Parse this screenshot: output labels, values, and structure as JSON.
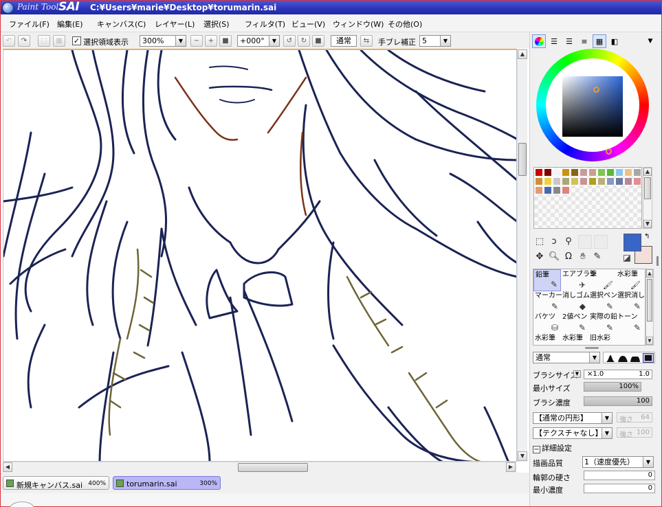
{
  "titlebar": {
    "logo_text": "Paint Tool",
    "logo_brand": "SAI",
    "path": "C:¥Users¥marie¥Desktop¥torumarin.sai"
  },
  "menu": [
    {
      "label": "ファイル(F)"
    },
    {
      "label": "編集(E)"
    },
    {
      "label": "キャンバス(C)"
    },
    {
      "label": "レイヤー(L)"
    },
    {
      "label": "選択(S)"
    },
    {
      "label": "フィルタ(T)"
    },
    {
      "label": "ビュー(V)"
    },
    {
      "label": "ウィンドウ(W)"
    },
    {
      "label": "その他(O)"
    }
  ],
  "toolbar": {
    "selection_display_label": "選択領域表示",
    "selection_display_checked": true,
    "zoom": "300%",
    "rotation": "+000°",
    "blend_mode": "通常",
    "stabilizer_label": "手ブレ補正",
    "stabilizer_value": "5"
  },
  "file_tabs": [
    {
      "name": "新規キャンバス.sai",
      "zoom": "400%",
      "active": false
    },
    {
      "name": "torumarin.sai",
      "zoom": "300%",
      "active": true
    }
  ],
  "colors": {
    "main": "#3866c8",
    "sub": "#f2dfd9",
    "line_art": "#1b2354",
    "skin_line": "#7a3318",
    "collar_line": "#6d6536"
  },
  "swatches": [
    "#c80000",
    "#800000",
    "#f4f4f4",
    "#c89214",
    "#8a6418",
    "#c89c9c",
    "#c8a090",
    "#7ac850",
    "#58b838",
    "#8ac8e8",
    "#f0c080",
    "#a8a8a8",
    "#d09030",
    "#f0d040",
    "#c8c8c8",
    "#a8a870",
    "#d0c060",
    "#c89498",
    "#b0a020",
    "#b8b078",
    "#8898c0",
    "#6878a0",
    "#b88898",
    "#e09090",
    "#e89870",
    "#4868b0",
    "#888888",
    "#e08080"
  ],
  "brushes": [
    {
      "label": "鉛筆",
      "icon": "pencil-icon",
      "active": true
    },
    {
      "label": "エアブラシ",
      "icon": "airbrush-icon",
      "active": false
    },
    {
      "label": "筆",
      "icon": "brush-icon",
      "active": false
    },
    {
      "label": "水彩筆",
      "icon": "watercolor-icon",
      "active": false
    },
    {
      "label": "マーカー",
      "icon": "marker-icon",
      "active": false
    },
    {
      "label": "消しゴム",
      "icon": "eraser-icon",
      "active": false
    },
    {
      "label": "選択ペン",
      "icon": "select-pen-icon",
      "active": false
    },
    {
      "label": "選択消し",
      "icon": "select-erase-icon",
      "active": false
    },
    {
      "label": "バケツ",
      "icon": "bucket-icon",
      "active": false
    },
    {
      "label": "2値ペン",
      "icon": "binary-pen-icon",
      "active": false
    },
    {
      "label": "実際の鉛",
      "icon": "real-pencil-icon",
      "active": false
    },
    {
      "label": "トーン",
      "icon": "tone-icon",
      "active": false
    },
    {
      "label": "水彩筆",
      "icon": "watercolor-icon",
      "active": false
    },
    {
      "label": "水彩筆",
      "icon": "watercolor-icon",
      "active": false
    },
    {
      "label": "旧水彩",
      "icon": "old-watercolor-icon",
      "active": false
    }
  ],
  "brush_panel": {
    "blend_mode": "通常",
    "brush_size_label": "ブラシサイズ",
    "brush_size_mult": "×1.0",
    "brush_size_value": "1.0",
    "min_size_label": "最小サイズ",
    "min_size_value": "100%",
    "density_label": "ブラシ濃度",
    "density_value": "100",
    "shape_combo": "【通常の円形】",
    "shape_strength_label": "強さ",
    "shape_strength_value": "64",
    "texture_combo": "【テクスチャなし】",
    "texture_strength_label": "強さ",
    "texture_strength_value": "100",
    "detail_header": "詳細設定",
    "quality_label": "描画品質",
    "quality_value": "1（速度優先）",
    "edge_hardness_label": "輪郭の硬さ",
    "edge_hardness_value": "0",
    "min_density_label": "最小濃度",
    "min_density_value": "0"
  },
  "color_wheel": {
    "hue_color": "#2c66d9"
  }
}
